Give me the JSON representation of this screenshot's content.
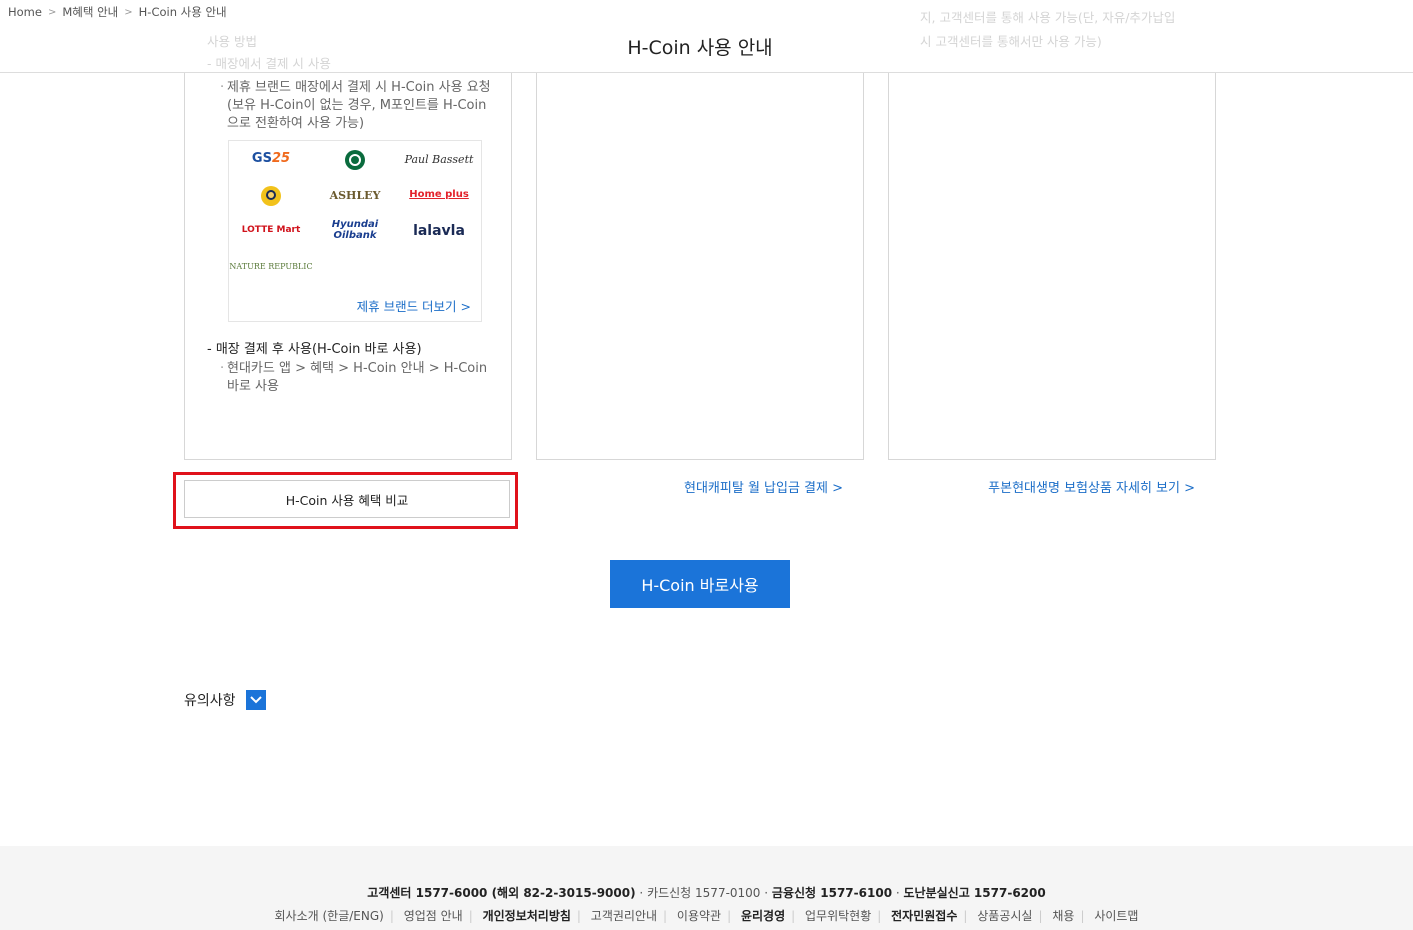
{
  "breadcrumb": {
    "home": "Home",
    "level1": "M혜택 안내",
    "current": "H-Coin 사용 안내",
    "sep": ">"
  },
  "page_title": "H-Coin 사용 안내",
  "faded_top": {
    "left_line1": "사용 방법",
    "left_line2": "- 매장에서 결제 시 사용",
    "right_line1": "지, 고객센터를 통해 사용 가능(단, 자유/추가납입",
    "right_line2": "시 고객센터를 통해서만 사용 가능)"
  },
  "card1": {
    "desc": "제휴 브랜드 매장에서 결제 시 H-Coin 사용 요청(보유 H-Coin이 없는 경우, M포인트를 H-Coin으로 전환하여 사용 가능)",
    "brands": [
      "GS25",
      "STARBUCKS",
      "Paul Bassett",
      "",
      "ASHLEY",
      "Home plus",
      "LOTTE Mart",
      "Hyundai Oilbank",
      "lalavla",
      "NATURE REPUBLIC"
    ],
    "more_link": "제휴 브랜드 더보기 >",
    "sub_title": "- 매장 결제 후 사용(H-Coin 바로 사용)",
    "sub_desc": "현대카드 앱 > 혜택 > H-Coin 안내 > H-Coin 바로 사용"
  },
  "card2": {
    "link": "현대캐피탈 월 납입금 결제 >"
  },
  "card3": {
    "link": "푸본현대생명 보험상품 자세히 보기 >"
  },
  "compare_button": "H-Coin 사용 혜택 비교",
  "primary_button": "H-Coin 바로사용",
  "notes": {
    "label": "유의사항"
  },
  "footer": {
    "row1": {
      "customer": "고객센터 1577-6000 (해외 82-2-3015-9000)",
      "card_apply": "카드신청 1577-0100",
      "finance_apply": "금융신청 1577-6100",
      "lost_report": "도난분실신고 1577-6200"
    },
    "row2": [
      "회사소개 (한글/ENG)",
      "영업점 안내",
      "개인정보처리방침",
      "고객권리안내",
      "이용약관",
      "윤리경영",
      "업무위탁현황",
      "전자민원접수",
      "상품공시실",
      "채용",
      "사이트맵"
    ]
  },
  "colors": {
    "accent": "#1b74d9",
    "highlight": "#e0121b",
    "link": "#1c6ec8"
  }
}
